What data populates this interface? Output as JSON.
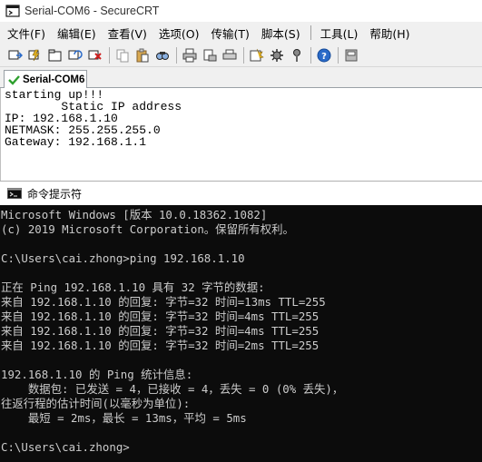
{
  "securecrt": {
    "window_title": "Serial-COM6 - SecureCRT",
    "menu": [
      "文件(F)",
      "编辑(E)",
      "查看(V)",
      "选项(O)",
      "传输(T)",
      "脚本(S)",
      "工具(L)",
      "帮助(H)"
    ],
    "toolbar_icons": [
      "connect-icon",
      "quick-connect-icon",
      "connect-in-tab-icon",
      "reconnect-icon",
      "disconnect-icon",
      "copy-icon",
      "paste-icon",
      "find-icon",
      "print-icon",
      "print-setup-icon",
      "print-selection-icon",
      "session-options-icon",
      "global-options-icon",
      "keymap-icon",
      "help-icon",
      "sftp-icon"
    ],
    "tab": {
      "label": "Serial-COM6",
      "status_icon": "check-icon",
      "status_color": "#2ea02e"
    },
    "session_lines": [
      "starting up!!!",
      "",
      "        Static IP address",
      "IP: 192.168.1.10",
      "NETMASK: 255.255.255.0",
      "Gateway: 192.168.1.1"
    ]
  },
  "cmd": {
    "window_title": "命令提示符",
    "lines": [
      "Microsoft Windows [版本 10.0.18362.1082]",
      "(c) 2019 Microsoft Corporation。保留所有权利。",
      "",
      "C:\\Users\\cai.zhong>ping 192.168.1.10",
      "",
      "正在 Ping 192.168.1.10 具有 32 字节的数据:",
      "来自 192.168.1.10 的回复: 字节=32 时间=13ms TTL=255",
      "来自 192.168.1.10 的回复: 字节=32 时间=4ms TTL=255",
      "来自 192.168.1.10 的回复: 字节=32 时间=4ms TTL=255",
      "来自 192.168.1.10 的回复: 字节=32 时间=2ms TTL=255",
      "",
      "192.168.1.10 的 Ping 统计信息:",
      "    数据包: 已发送 = 4，已接收 = 4，丢失 = 0 (0% 丢失)，",
      "往返行程的估计时间(以毫秒为单位):",
      "    最短 = 2ms，最长 = 13ms，平均 = 5ms",
      "",
      "C:\\Users\\cai.zhong>"
    ]
  }
}
